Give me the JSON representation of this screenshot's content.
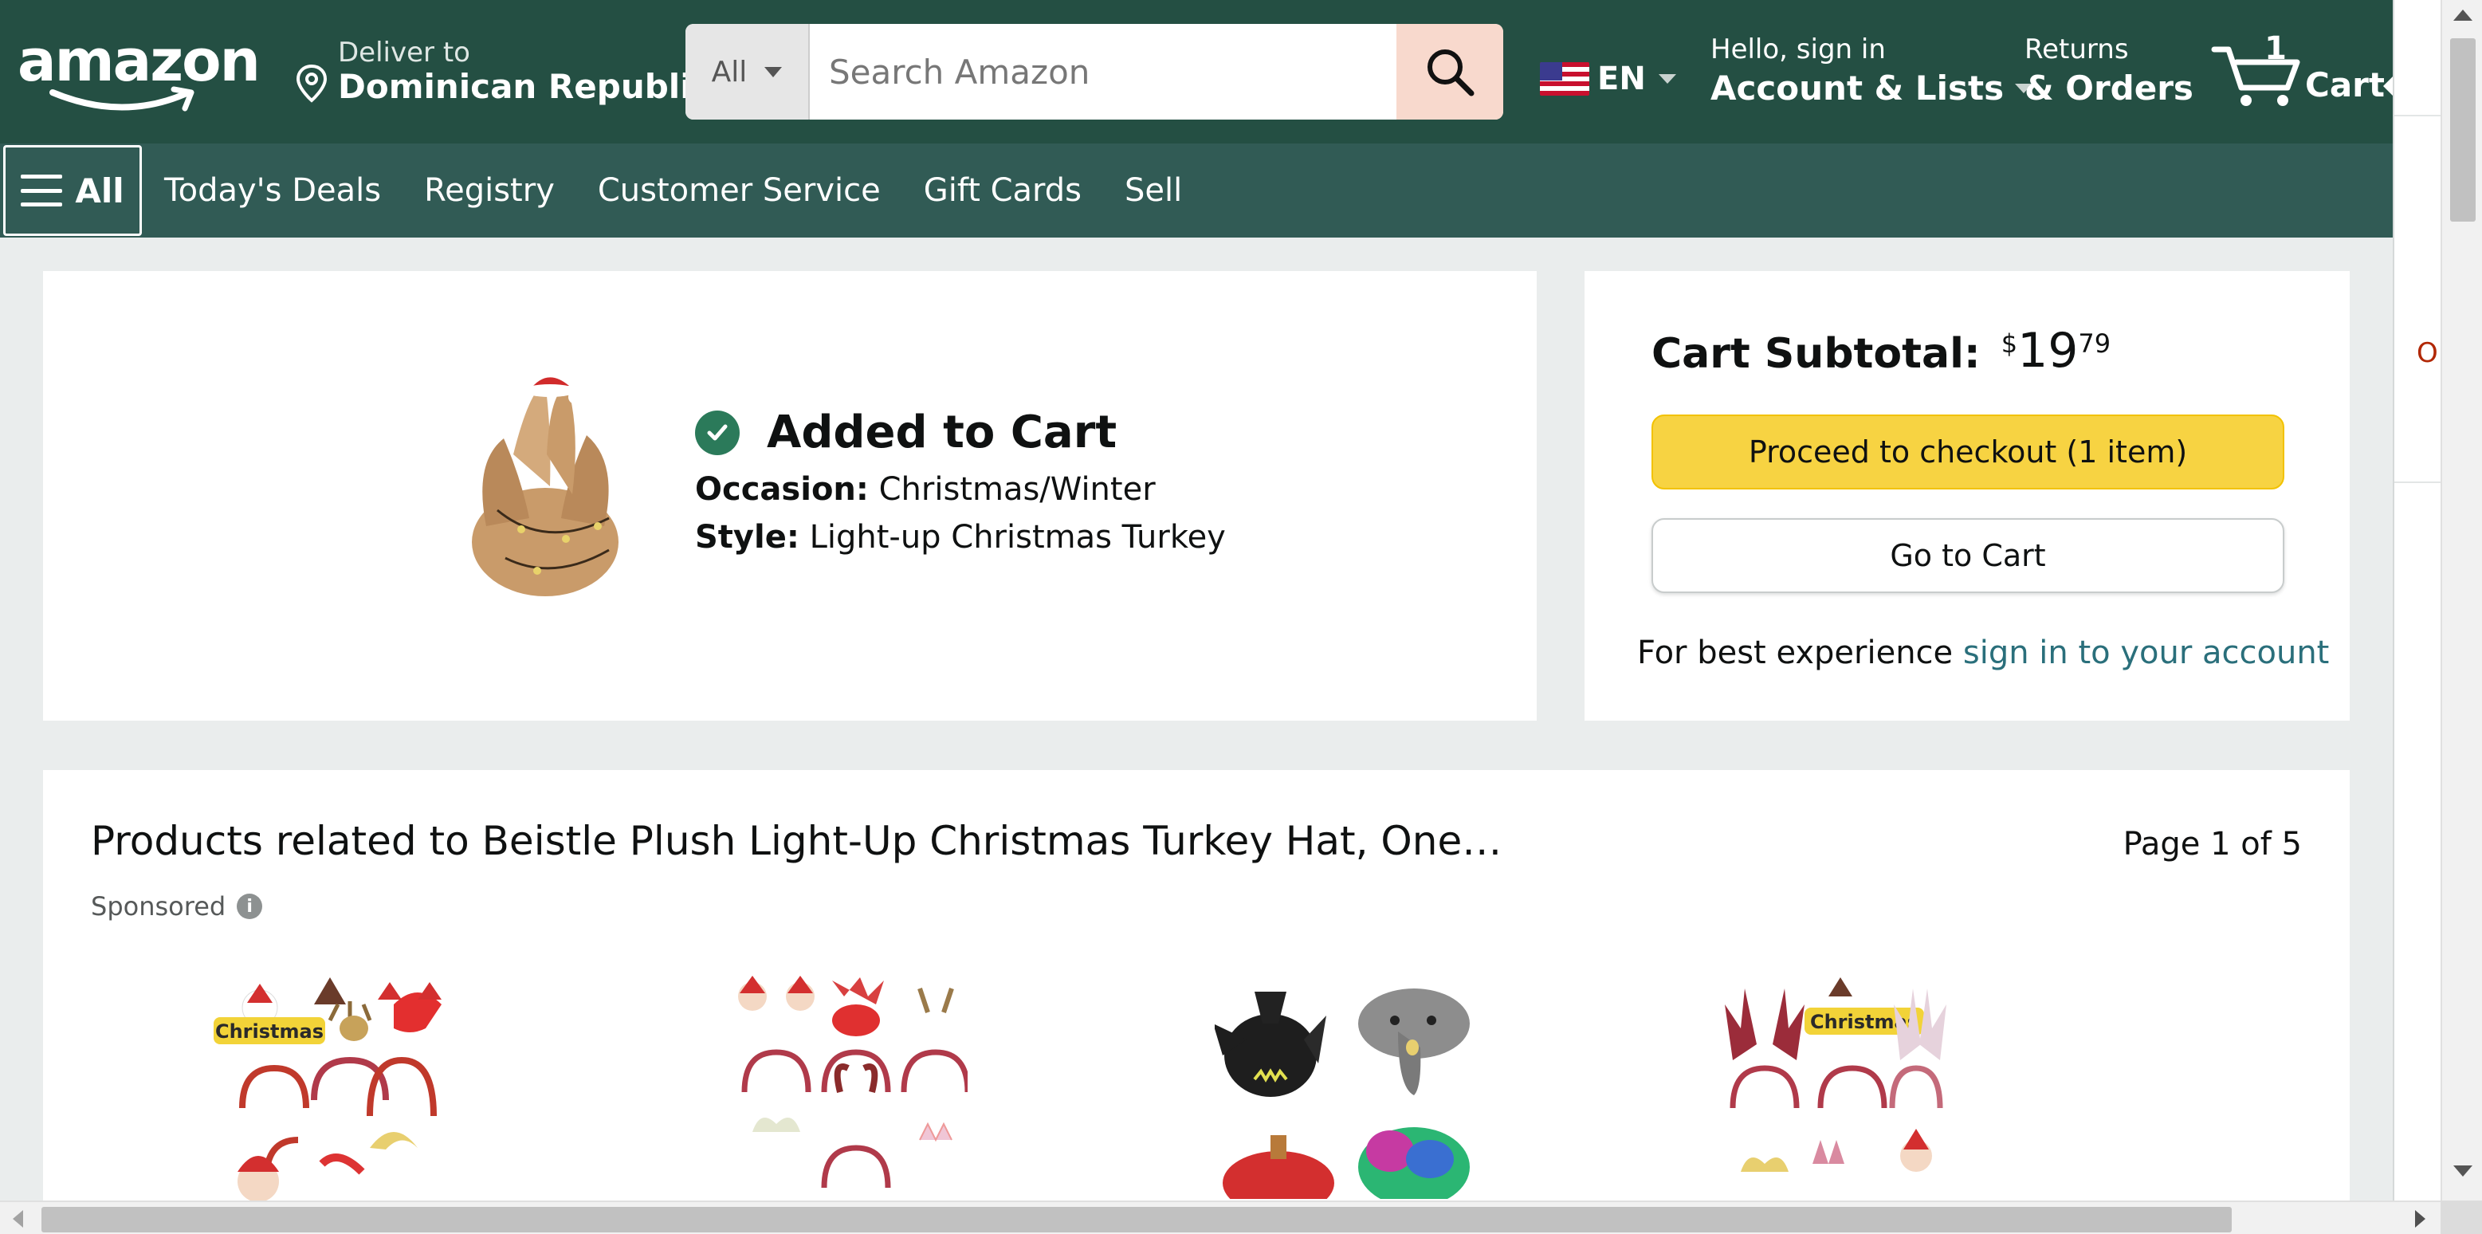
{
  "header": {
    "logo_text": "amazon",
    "deliver_line1": "Deliver to",
    "deliver_line2": "Dominican Republic",
    "search_category": "All",
    "search_placeholder": "Search Amazon",
    "language": "EN",
    "account_line1": "Hello, sign in",
    "account_line2": "Account & Lists",
    "returns_line1": "Returns",
    "returns_line2": "& Orders",
    "cart_count": "1",
    "cart_label": "Cart",
    "colors": {
      "topbar": "#244f43",
      "navbar": "#315b55",
      "search_button": "#f8d9cd"
    }
  },
  "nav": {
    "all_label": "All",
    "links": [
      "Today's Deals",
      "Registry",
      "Customer Service",
      "Gift Cards",
      "Sell"
    ]
  },
  "added": {
    "title": "Added to Cart",
    "occasion_label": "Occasion:",
    "occasion_value": "Christmas/Winter",
    "style_label": "Style:",
    "style_value": "Light-up Christmas Turkey"
  },
  "subtotal": {
    "label": "Cart Subtotal:",
    "currency": "$",
    "whole": "19",
    "fraction": "79",
    "checkout_label": "Proceed to checkout (1 item)",
    "go_to_cart_label": "Go to Cart",
    "best_text": "For best experience",
    "sign_in_link": "sign in to your account",
    "colors": {
      "checkout": "#f7d342",
      "link": "#2a6f7b"
    }
  },
  "related": {
    "title": "Products related to Beistle Plush Light-Up Christmas Turkey Hat, One…",
    "page": "Page 1 of 5",
    "sponsored": "Sponsored",
    "products": [
      {
        "name": "christmas-headbands-set-1",
        "badge": "Christmas"
      },
      {
        "name": "christmas-headbands-set-2"
      },
      {
        "name": "animal-plush-hats"
      },
      {
        "name": "christmas-headbands-set-3",
        "badge": "Christmas"
      }
    ]
  },
  "side_peek": {
    "text": "O st",
    "color": "#b12704"
  }
}
